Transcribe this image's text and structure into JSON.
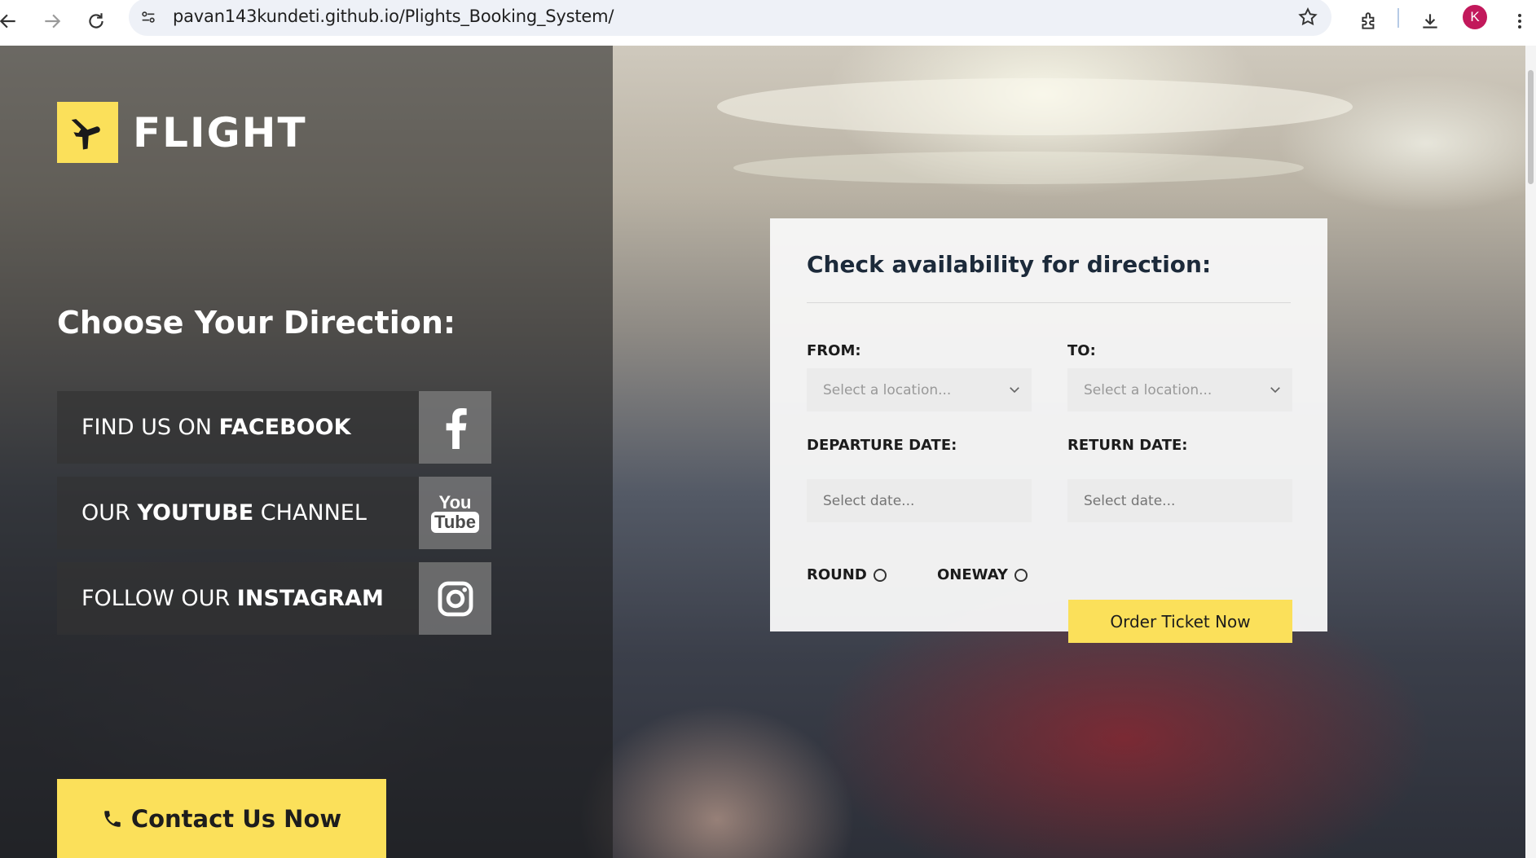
{
  "browser": {
    "url": "pavan143kundeti.github.io/Plights_Booking_System/",
    "profile_initial": "K",
    "icons": [
      "back-icon",
      "forward-icon",
      "reload-icon",
      "site-info-icon",
      "bookmark-star-icon",
      "extensions-icon",
      "download-icon",
      "menu-icon"
    ]
  },
  "brand": {
    "name": "FLIGHT",
    "accent": "#fbe05a"
  },
  "sidebar": {
    "title": "Choose Your Direction:",
    "social": [
      {
        "prefix": "FIND US ON ",
        "bold": "FACEBOOK",
        "suffix": "",
        "icon": "facebook-icon"
      },
      {
        "prefix": "OUR ",
        "bold": "YOUTUBE",
        "suffix": " CHANNEL",
        "icon": "youtube-icon",
        "icon_text_1": "You",
        "icon_text_2": "Tube"
      },
      {
        "prefix": "FOLLOW OUR ",
        "bold": "INSTAGRAM",
        "suffix": "",
        "icon": "instagram-icon"
      }
    ],
    "contact_label": "Contact Us Now"
  },
  "booking": {
    "title": "Check availability for direction:",
    "from_label": "FROM:",
    "to_label": "TO:",
    "from_placeholder": "Select a location...",
    "to_placeholder": "Select a location...",
    "departure_label": "DEPARTURE DATE:",
    "return_label": "RETURN DATE:",
    "departure_placeholder": "Select date...",
    "return_placeholder": "Select date...",
    "round_label": "ROUND",
    "oneway_label": "ONEWAY",
    "order_label": "Order Ticket Now"
  }
}
